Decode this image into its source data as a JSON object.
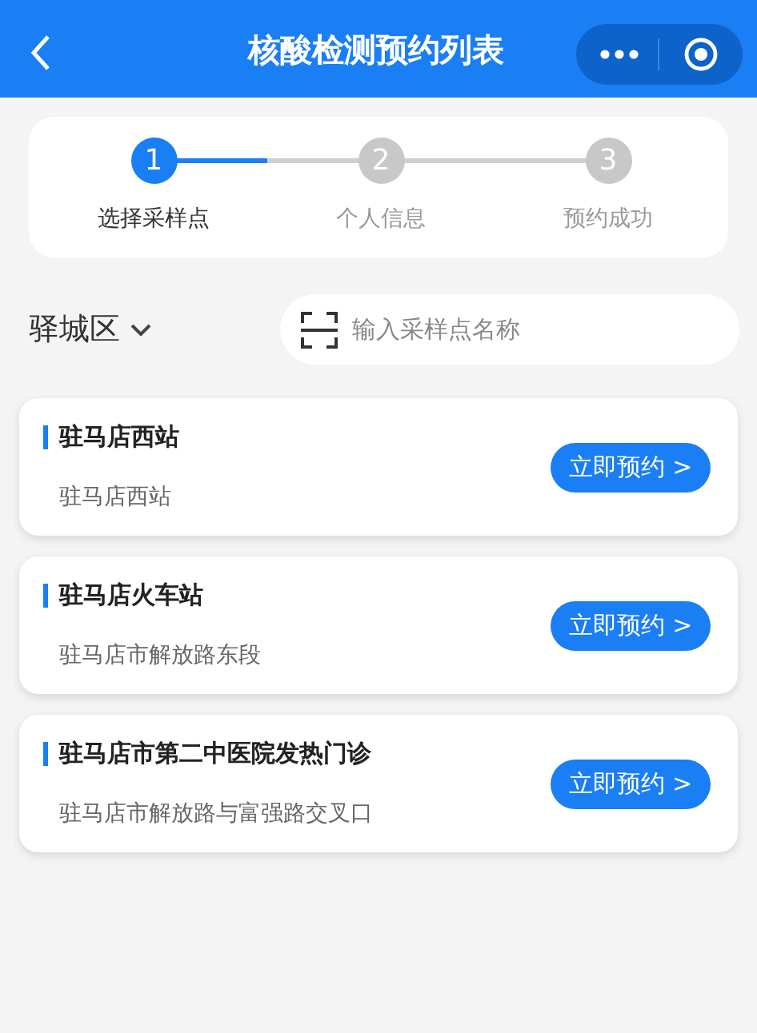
{
  "header": {
    "title": "核酸检测预约列表"
  },
  "steps": [
    {
      "number": "1",
      "label": "选择采样点",
      "selected": true
    },
    {
      "number": "2",
      "label": "个人信息",
      "selected": false
    },
    {
      "number": "3",
      "label": "预约成功",
      "selected": false
    }
  ],
  "district": "驿城区",
  "search": {
    "placeholder": "输入采样点名称"
  },
  "sites": [
    {
      "name": "驻马店西站",
      "address": "驻马店西站",
      "action": "立即预约 >"
    },
    {
      "name": "驻马店火车站",
      "address": "驻马店市解放路东段",
      "action": "立即预约 >"
    },
    {
      "name": "驻马店市第二中医院发热门诊",
      "address": "驻马店市解放路与富强路交叉口",
      "action": "立即预约 >"
    }
  ]
}
